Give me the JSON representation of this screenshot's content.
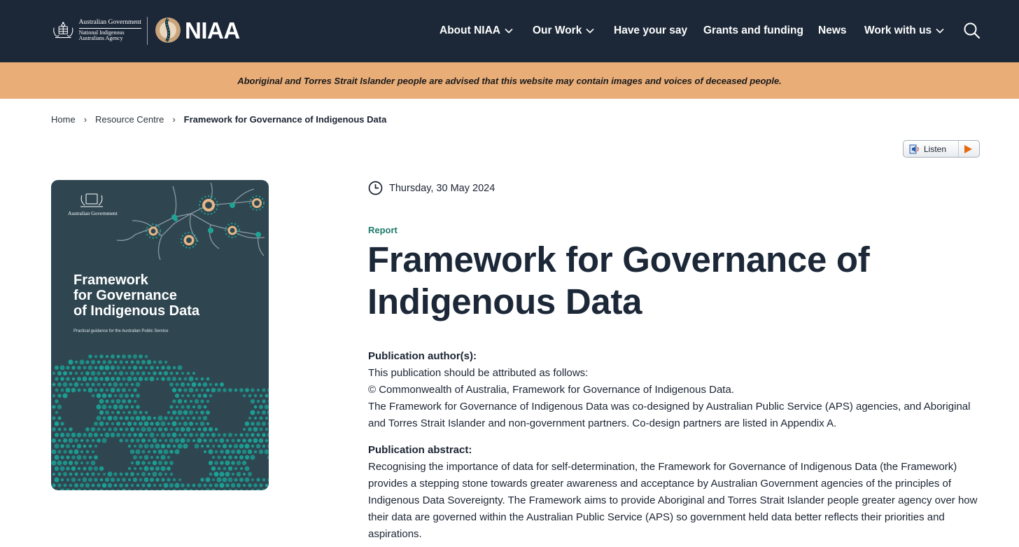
{
  "header": {
    "gov_name": "Australian Government",
    "agency_name_line1": "National Indigenous",
    "agency_name_line2": "Australians Agency",
    "brand": "NIAA",
    "nav": [
      {
        "label": "About NIAA",
        "has_dropdown": true
      },
      {
        "label": "Our Work",
        "has_dropdown": true
      },
      {
        "label": "Have your say",
        "has_dropdown": false
      },
      {
        "label": "Grants and funding",
        "has_dropdown": false
      },
      {
        "label": "News",
        "has_dropdown": false
      },
      {
        "label": "Work with us",
        "has_dropdown": true
      }
    ],
    "search_icon": "search-icon"
  },
  "banner": {
    "text": "Aboriginal and Torres Strait Islander people are advised that this website may contain images and voices of deceased people."
  },
  "breadcrumb": {
    "items": [
      "Home",
      "Resource Centre",
      "Framework for Governance of Indigenous Data"
    ]
  },
  "listen": {
    "label": "Listen"
  },
  "cover": {
    "gov_name": "Australian Government",
    "title_line1": "Framework",
    "title_line2": "for Governance",
    "title_line3": "of Indigenous Data",
    "subtitle": "Practical guidance for the Australian Public Service"
  },
  "article": {
    "date": "Thursday, 30 May 2024",
    "type": "Report",
    "title": "Framework for Governance of Indigenous Data",
    "authors_heading": "Publication author(s):",
    "authors_lines": [
      "This publication should be attributed as follows:",
      "© Commonwealth of Australia, Framework for Governance of Indigenous Data.",
      "The Framework for Governance of Indigenous Data was co-designed by Australian Public Service (APS) agencies, and Aboriginal and Torres Strait Islander and non-government partners. Co-design partners are listed in Appendix A."
    ],
    "abstract_heading": "Publication abstract:",
    "abstract": "Recognising the importance of data for self-determination, the Framework for Governance of Indigenous Data (the Framework) provides a stepping stone towards greater awareness and acceptance by Australian Government agencies of the principles of Indigenous Data Sovereignty. The Framework aims to provide Aboriginal and Torres Strait Islander people greater agency over how their data are governed within the Australian Public Service (APS) so government held data better reflects their priorities and aspirations."
  },
  "colors": {
    "header_bg": "#1c2838",
    "banner_bg": "#e9ad78",
    "accent_teal": "#1f7a6d",
    "cover_bg": "#2f4651",
    "cover_dots": "#1ba295"
  }
}
